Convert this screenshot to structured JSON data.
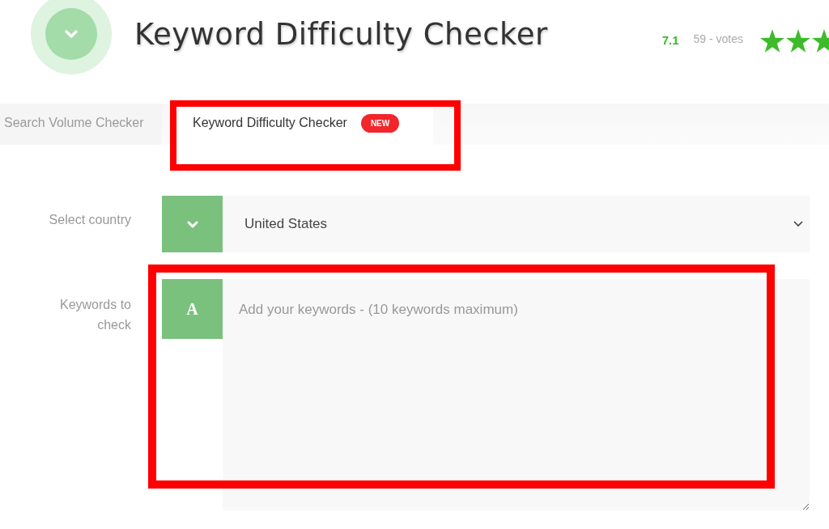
{
  "header": {
    "title": "Keyword Difficulty Checker",
    "score": "7.1",
    "votes": "59 - votes",
    "stars": 3
  },
  "tabs": [
    {
      "label": "Search Volume Checker",
      "selected": false
    },
    {
      "label": "Keyword Difficulty Checker",
      "selected": true,
      "badge": "NEW"
    }
  ],
  "form": {
    "country_label": "Select country",
    "country_value": "United States",
    "keywords_label": "Keywords to check",
    "keywords_icon": "A",
    "keywords_placeholder": "Add your keywords - (10 keywords maximum)"
  },
  "annotations": [
    {
      "kind": "frame"
    },
    {
      "kind": "frame"
    }
  ]
}
